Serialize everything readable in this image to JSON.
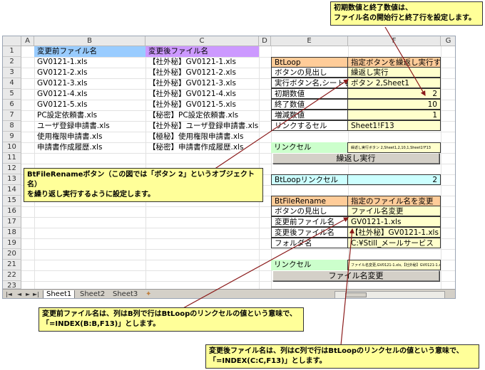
{
  "spreadsheet": {
    "columns": [
      "A",
      "B",
      "C",
      "D",
      "E",
      "F",
      "G"
    ],
    "rows": [
      "1",
      "2",
      "3",
      "4",
      "5",
      "6",
      "7",
      "8",
      "9",
      "10",
      "11",
      "12",
      "13",
      "14",
      "15",
      "16",
      "17",
      "18",
      "19",
      "20",
      "21",
      "22",
      "23"
    ],
    "header_b": "変更前ファイル名",
    "header_c": "変更後ファイル名",
    "list_b": [
      "GV0121-1.xls",
      "GV0121-2.xls",
      "GV0121-3.xls",
      "GV0121-4.xls",
      "GV0121-5.xls",
      "PC設定依頼書.xls",
      "ユーザ登録申請書.xls",
      "使用権限申請書.xls",
      "申請書作成履歴.xls"
    ],
    "list_c": [
      "【社外秘】GV0121-1.xls",
      "【社外秘】GV0121-2.xls",
      "【社外秘】GV0121-3.xls",
      "【社外秘】GV0121-4.xls",
      "【社外秘】GV0121-5.xls",
      "【秘密】PC設定依頼書.xls",
      "【社外秘】ユーザ登録申請書.xls",
      "【極秘】使用権限申請書.xls",
      "【秘密】申請書作成履歴.xls"
    ],
    "btloop": {
      "title": "BtLoop",
      "title_desc": "指定ボタンを繰返し実行する",
      "labels": [
        "ボタンの見出し",
        "実行ボタン名,シート名",
        "初期数値",
        "終了数値",
        "増減数値",
        "リンクするセル"
      ],
      "values": [
        "繰返し実行",
        "ボタン 2,Sheet1",
        "2",
        "10",
        "1",
        "Sheet1!F13"
      ],
      "link_label": "リンクセル",
      "link_value": "繰返し実行ボタン 2,Sheet1,2,10,1,Sheet1!F13",
      "button": "繰返し実行"
    },
    "btloop_link": {
      "label": "BtLoopリンクセル",
      "value": "2"
    },
    "btfile": {
      "title": "BtFileRename",
      "title_desc": "指定のファイル名を変更",
      "labels": [
        "ボタンの見出し",
        "変更前ファイル名",
        "変更後ファイル名",
        "フォルダ名"
      ],
      "values": [
        "ファイル名変更",
        "GV0121-1.xls",
        "【社外秘】GV0121-1.xls",
        "C:¥Still_メールサービス"
      ],
      "link_label": "リンクセル",
      "link_value": "ファイル名変更,GV0121-1.xls,【社外秘】GV0121-1.xls,C:¥Still_メールサービス",
      "button": "ファイル名変更"
    },
    "tabs": [
      "Sheet1",
      "Sheet2",
      "Sheet3"
    ],
    "nav_glyphs": [
      "|◄",
      "◄",
      "►",
      "►|"
    ]
  },
  "callouts": {
    "top_right": [
      "初期数値と終了数値は、",
      "ファイル名の開始行と終了行を設定します。"
    ],
    "middle_left": [
      "BtFileRenameボタン（この図では「ボタン 2」というオブジェクト名）",
      "を繰り返し実行するように設定します。"
    ],
    "bottom_left": [
      "変更前ファイル名は、列はB列で行はBtLoopのリンクセルの値という意味で、",
      "「=INDEX(B:B,F13)」とします。"
    ],
    "bottom_right": [
      "変更後ファイル名は、列はC列で行はBtLoopのリンクセルの値という意味で、",
      "「=INDEX(C:C,F13)」とします。"
    ]
  },
  "colors": {
    "header_b": "#99ccff",
    "header_c": "#cc99ff",
    "orange": "#ffcc99",
    "yellow": "#ffffcc",
    "green": "#ccffcc",
    "cyan": "#ccffff",
    "callout": "#ffff99",
    "arrow": "#8b1a1a"
  }
}
